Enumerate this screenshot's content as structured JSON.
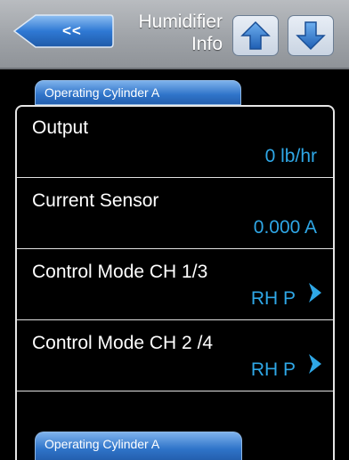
{
  "header": {
    "back_label": "<<",
    "title_line1": "Humidifier",
    "title_line2": "Info"
  },
  "tabs": {
    "top": "Operating Cylinder A",
    "bottom": "Operating Cylinder A"
  },
  "rows": [
    {
      "label": "Output",
      "value": "0 lb/hr"
    },
    {
      "label": "Current Sensor",
      "value": "0.000 A"
    },
    {
      "label": "Control Mode CH 1/3",
      "value": "RH P"
    },
    {
      "label": "Control Mode CH 2 /4",
      "value": "RH P"
    }
  ],
  "colors": {
    "accent_blue": "#2f74c9",
    "value_blue": "#2fa7e6",
    "header_gray": "#a3a7ac"
  },
  "icons": {
    "back": "back-arrow-icon",
    "up": "arrow-up-icon",
    "down": "arrow-down-icon",
    "chevron": "chevron-right-icon"
  }
}
